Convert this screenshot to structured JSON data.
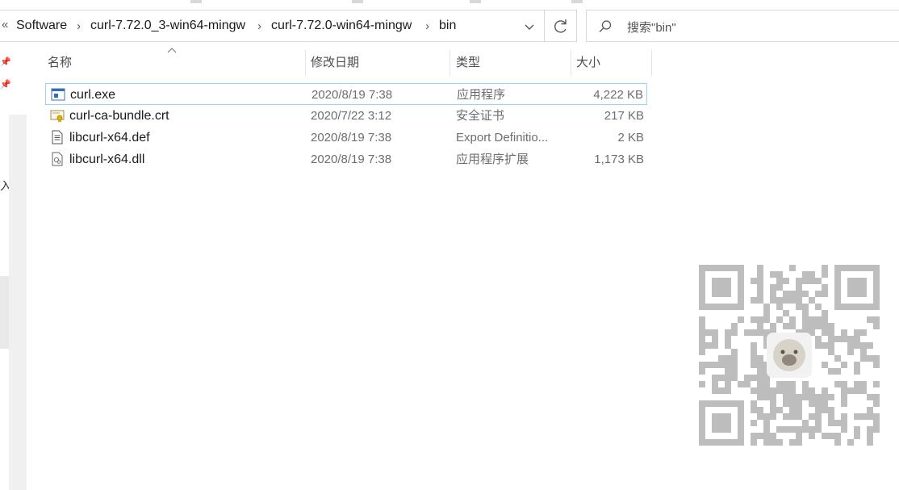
{
  "address": {
    "overflow": "«",
    "crumbs": [
      "Software",
      "curl-7.72.0_3-win64-mingw",
      "curl-7.72.0-win64-mingw",
      "bin"
    ]
  },
  "search": {
    "placeholder": "搜索\"bin\""
  },
  "leftpane": {
    "ime_char": "入"
  },
  "columns": {
    "name": "名称",
    "date": "修改日期",
    "type": "类型",
    "size": "大小"
  },
  "files": [
    {
      "name": "curl.exe",
      "date": "2020/8/19 7:38",
      "type": "应用程序",
      "size": "4,222 KB",
      "icon": "exe-icon"
    },
    {
      "name": "curl-ca-bundle.crt",
      "date": "2020/7/22 3:12",
      "type": "安全证书",
      "size": "217 KB",
      "icon": "certificate-icon"
    },
    {
      "name": "libcurl-x64.def",
      "date": "2020/8/19 7:38",
      "type": "Export Definitio...",
      "size": "2 KB",
      "icon": "text-file-icon"
    },
    {
      "name": "libcurl-x64.dll",
      "date": "2020/8/19 7:38",
      "type": "应用程序扩展",
      "size": "1,173 KB",
      "icon": "dll-icon"
    }
  ],
  "selected_row": 0,
  "colors": {
    "selection_border": "#99d1ff",
    "secondary_text": "#6d6d6d"
  }
}
